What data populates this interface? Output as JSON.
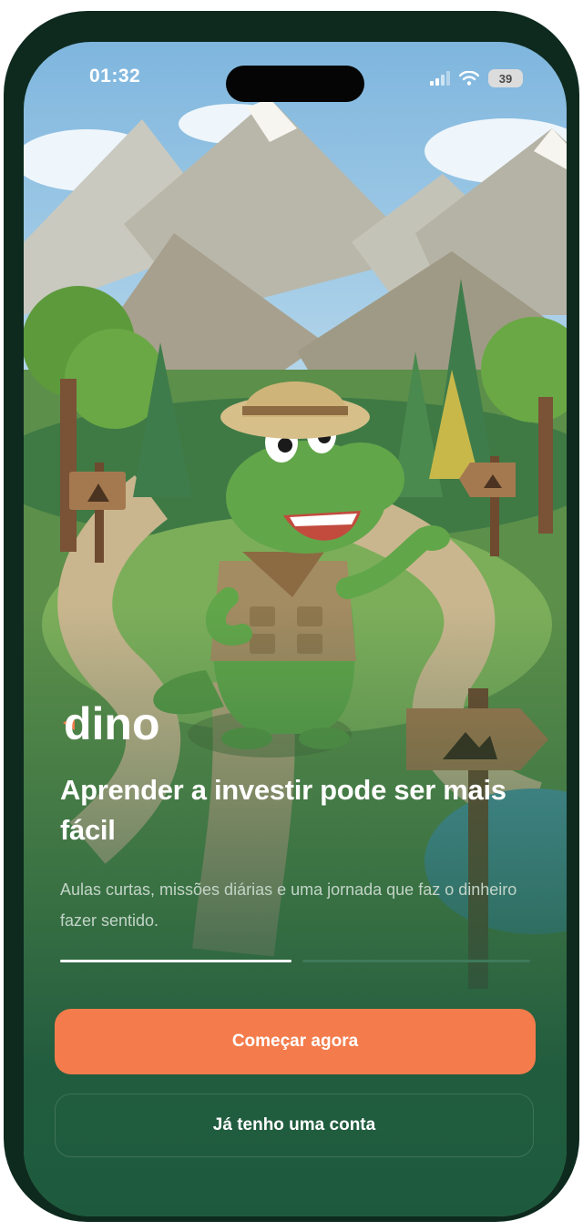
{
  "status_bar": {
    "time": "01:32",
    "battery": "39",
    "icons": [
      "signal-icon",
      "wifi-icon",
      "battery-icon"
    ]
  },
  "brand": {
    "logo_text": "dino",
    "accent": "#f47c4c"
  },
  "hero": {
    "image": "explorer-dino-mascot-illustration",
    "headline": "Aprender a investir pode ser mais fácil",
    "subtitle": "Aulas curtas, missões diárias e uma jornada que faz o dinheiro fazer sentido."
  },
  "onboarding_progress": {
    "steps": 2,
    "current": 1
  },
  "actions": {
    "primary_label": "Começar agora",
    "secondary_label": "Já tenho uma conta"
  },
  "colors": {
    "background_green": "#1f5a3e",
    "primary_button": "#f47c4c",
    "text": "#ffffff",
    "frame": "#0e2a1f"
  }
}
